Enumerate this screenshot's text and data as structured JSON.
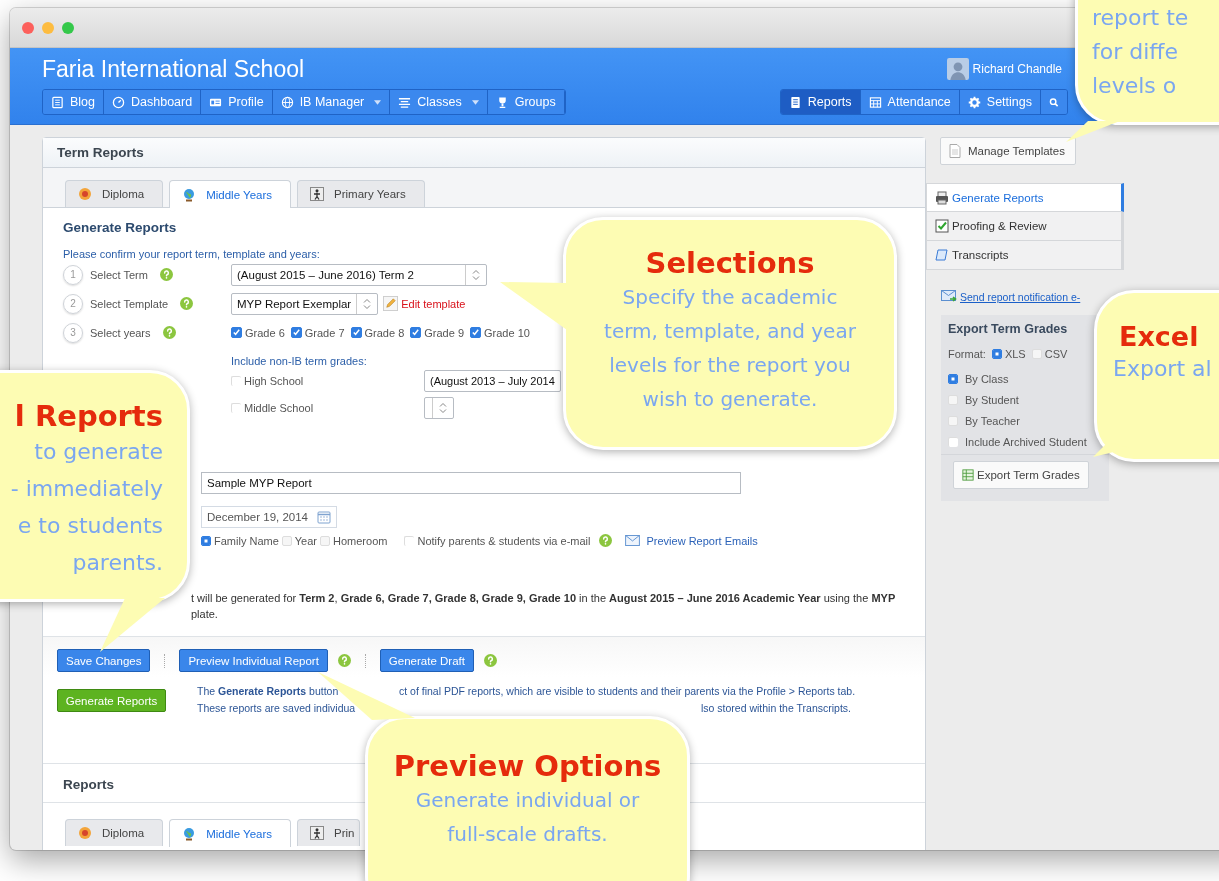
{
  "app": {
    "title": "Faria International School",
    "user_name": "Richard Chandle"
  },
  "nav_left": [
    {
      "label": "Blog",
      "kind": "blog",
      "dropdown": false
    },
    {
      "label": "Dashboard",
      "kind": "dashboard",
      "dropdown": false
    },
    {
      "label": "Profile",
      "kind": "profile",
      "dropdown": false
    },
    {
      "label": "IB Manager",
      "kind": "globe",
      "dropdown": true
    },
    {
      "label": "Classes",
      "kind": "classes",
      "dropdown": true
    },
    {
      "label": "Groups",
      "kind": "groups",
      "dropdown": false
    }
  ],
  "nav_right": [
    {
      "label": "Reports",
      "kind": "reports",
      "selected": true
    },
    {
      "label": "Attendance",
      "kind": "attendance",
      "selected": false
    },
    {
      "label": "Settings",
      "kind": "settings",
      "selected": false
    }
  ],
  "term_reports": {
    "title": "Term Reports",
    "tabs": [
      {
        "label": "Diploma",
        "kind": "diploma",
        "selected": false
      },
      {
        "label": "Middle Years",
        "kind": "middle",
        "selected": true
      },
      {
        "label": "Primary Years",
        "kind": "primary",
        "selected": false
      }
    ],
    "section_title": "Generate Reports",
    "instruction": "Please confirm your report term, template and years:",
    "steps": [
      {
        "number": "1",
        "label": "Select Term"
      },
      {
        "number": "2",
        "label": "Select Template"
      },
      {
        "number": "3",
        "label": "Select years"
      }
    ],
    "term_select": "(August 2015 – June 2016) Term 2",
    "template_select": "MYP Report Exemplar",
    "edit_template_link": "Edit template",
    "years": [
      {
        "label": "Grade 6",
        "checked": true
      },
      {
        "label": "Grade 7",
        "checked": true
      },
      {
        "label": "Grade 8",
        "checked": true
      },
      {
        "label": "Grade 9",
        "checked": true
      },
      {
        "label": "Grade 10",
        "checked": true
      }
    ],
    "non_ib_label": "Include non-IB term grades:",
    "non_ib": [
      {
        "label": "High School",
        "checked": false,
        "select_value": "(August 2013 – July 2014"
      },
      {
        "label": "Middle School",
        "checked": false
      }
    ],
    "report_name": "Sample MYP Report",
    "date": "December 19, 2014",
    "sort_options": [
      {
        "label": "Family Name",
        "selected": true
      },
      {
        "label": "Year",
        "selected": false
      },
      {
        "label": "Homeroom",
        "selected": false
      }
    ],
    "notify": {
      "label": "Notify parents & students via e-mail",
      "checked": false
    },
    "preview_emails_link": "Preview Report Emails",
    "summary_line_1": "t will be generated for **Term 2**, **Grade 6, Grade 7, Grade 8, Grade 9, Grade 10** in the **August 2015 – June 2016 Academic Year** using the **MYP**",
    "summary_line_2": "plate.",
    "buttons": {
      "save": "Save Changes",
      "preview": "Preview Individual Report",
      "draft": "Generate Draft",
      "generate": "Generate Reports"
    },
    "description": {
      "line_1_start": "The **Generate Reports** button",
      "line_1_end": "ct of final PDF reports, which are visible to students and their parents via the Profile > Reports tab.",
      "line_2_start": "These reports are saved individua",
      "line_2_end": "lso stored within the Transcripts."
    }
  },
  "reports_panel": {
    "title": "Reports",
    "tabs": [
      {
        "label": "Diploma",
        "kind": "diploma",
        "selected": false
      },
      {
        "label": "Middle Years",
        "kind": "middle",
        "selected": true
      },
      {
        "label": "Prin",
        "kind": "primary",
        "selected": false
      }
    ]
  },
  "sidebar": {
    "manage_templates": "Manage Templates",
    "menu": [
      {
        "label": "Generate Reports",
        "kind": "generate",
        "selected": true
      },
      {
        "label": "Proofing & Review",
        "kind": "proofing",
        "selected": false
      },
      {
        "label": "Transcripts",
        "kind": "transcripts",
        "selected": false
      }
    ],
    "notification_link": "Send report notification e-",
    "export": {
      "title": "Export Term Grades",
      "format_label": "Format:",
      "formats": [
        {
          "label": "XLS",
          "selected": true
        },
        {
          "label": "CSV",
          "selected": false
        }
      ],
      "groupings": [
        {
          "label": "By Class",
          "selected": true
        },
        {
          "label": "By Student",
          "selected": false
        },
        {
          "label": "By Teacher",
          "selected": false
        }
      ],
      "include_archived": {
        "label": "Include Archived Student",
        "checked": false
      },
      "button": "Export Term Grades"
    }
  },
  "callouts": [
    {
      "kind": "selections",
      "title": "Selections",
      "lines": [
        "Specify the academic",
        "term, template, and year",
        "levels for the report you",
        "wish to generate."
      ]
    },
    {
      "kind": "left",
      "title": "l Reports",
      "lines": [
        "to generate",
        "- immediately",
        "e to students",
        "parents."
      ]
    },
    {
      "kind": "top_right",
      "lines": [
        "report te",
        "for diffe",
        "levels o"
      ]
    },
    {
      "kind": "excel",
      "title": "Excel",
      "lines": [
        "Export al"
      ]
    },
    {
      "kind": "preview",
      "title": "Preview Options",
      "lines": [
        "Generate individual or",
        "full-scale drafts."
      ]
    }
  ]
}
